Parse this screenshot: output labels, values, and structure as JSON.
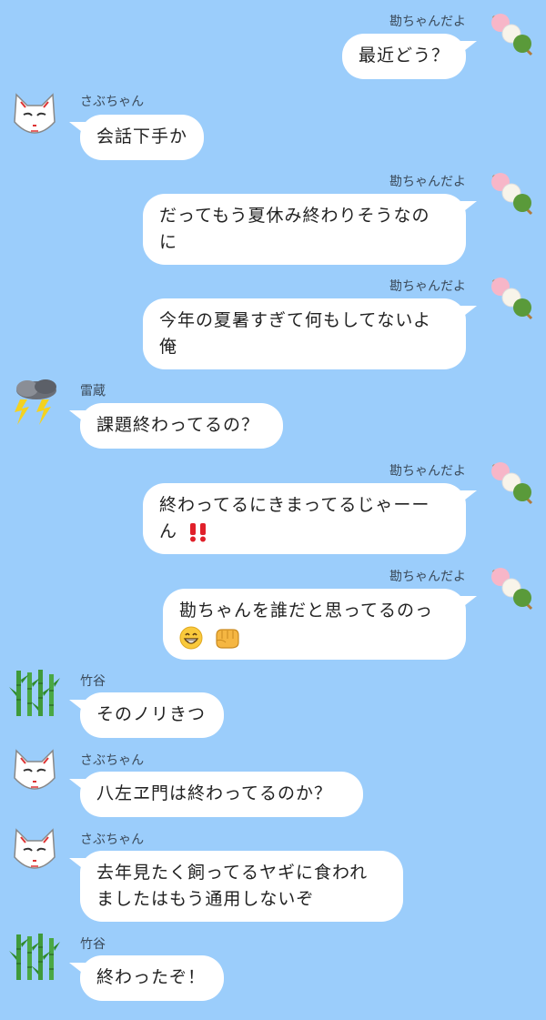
{
  "messages": [
    {
      "side": "right",
      "sender": "勘ちゃんだよ",
      "avatar": "dango-icon",
      "lines": [
        "最近どう？"
      ]
    },
    {
      "side": "left",
      "sender": "さぶちゃん",
      "avatar": "fox-mask-icon",
      "lines": [
        "会話下手か"
      ]
    },
    {
      "side": "right",
      "sender": "勘ちゃんだよ",
      "avatar": "dango-icon",
      "lines": [
        "だってもう夏休み終わりそうなの",
        "に"
      ]
    },
    {
      "side": "right",
      "sender": "勘ちゃんだよ",
      "avatar": "dango-icon",
      "lines": [
        "今年の夏暑すぎて何もしてないよ",
        "俺"
      ]
    },
    {
      "side": "left",
      "sender": "雷蔵",
      "avatar": "thunder-cloud-icon",
      "lines": [
        "課題終わってるの？"
      ]
    },
    {
      "side": "right",
      "sender": "勘ちゃんだよ",
      "avatar": "dango-icon",
      "lines": [
        "終わってるにきまってるじゃーー",
        "ん"
      ],
      "emojis": [
        "double-exclamation-icon"
      ]
    },
    {
      "side": "right",
      "sender": "勘ちゃんだよ",
      "avatar": "dango-icon",
      "lines": [
        "勘ちゃんを誰だと思ってるのっ",
        ""
      ],
      "emojis": [
        "grin-face-icon",
        "fist-icon"
      ]
    },
    {
      "side": "left",
      "sender": "竹谷",
      "avatar": "bamboo-icon",
      "lines": [
        "そのノリきつ"
      ]
    },
    {
      "side": "left",
      "sender": "さぶちゃん",
      "avatar": "fox-mask-icon",
      "lines": [
        "八左ヱ門は終わってるのか？"
      ]
    },
    {
      "side": "left",
      "sender": "さぶちゃん",
      "avatar": "fox-mask-icon",
      "lines": [
        "去年見たく飼ってるヤギに食われ",
        "ましたはもう通用しないぞ"
      ]
    },
    {
      "side": "left",
      "sender": "竹谷",
      "avatar": "bamboo-icon",
      "lines": [
        "終わったぞ！"
      ]
    }
  ],
  "colors": {
    "background": "#9bcdfb",
    "bubble": "#ffffff",
    "exclamation": "#e0202a"
  }
}
